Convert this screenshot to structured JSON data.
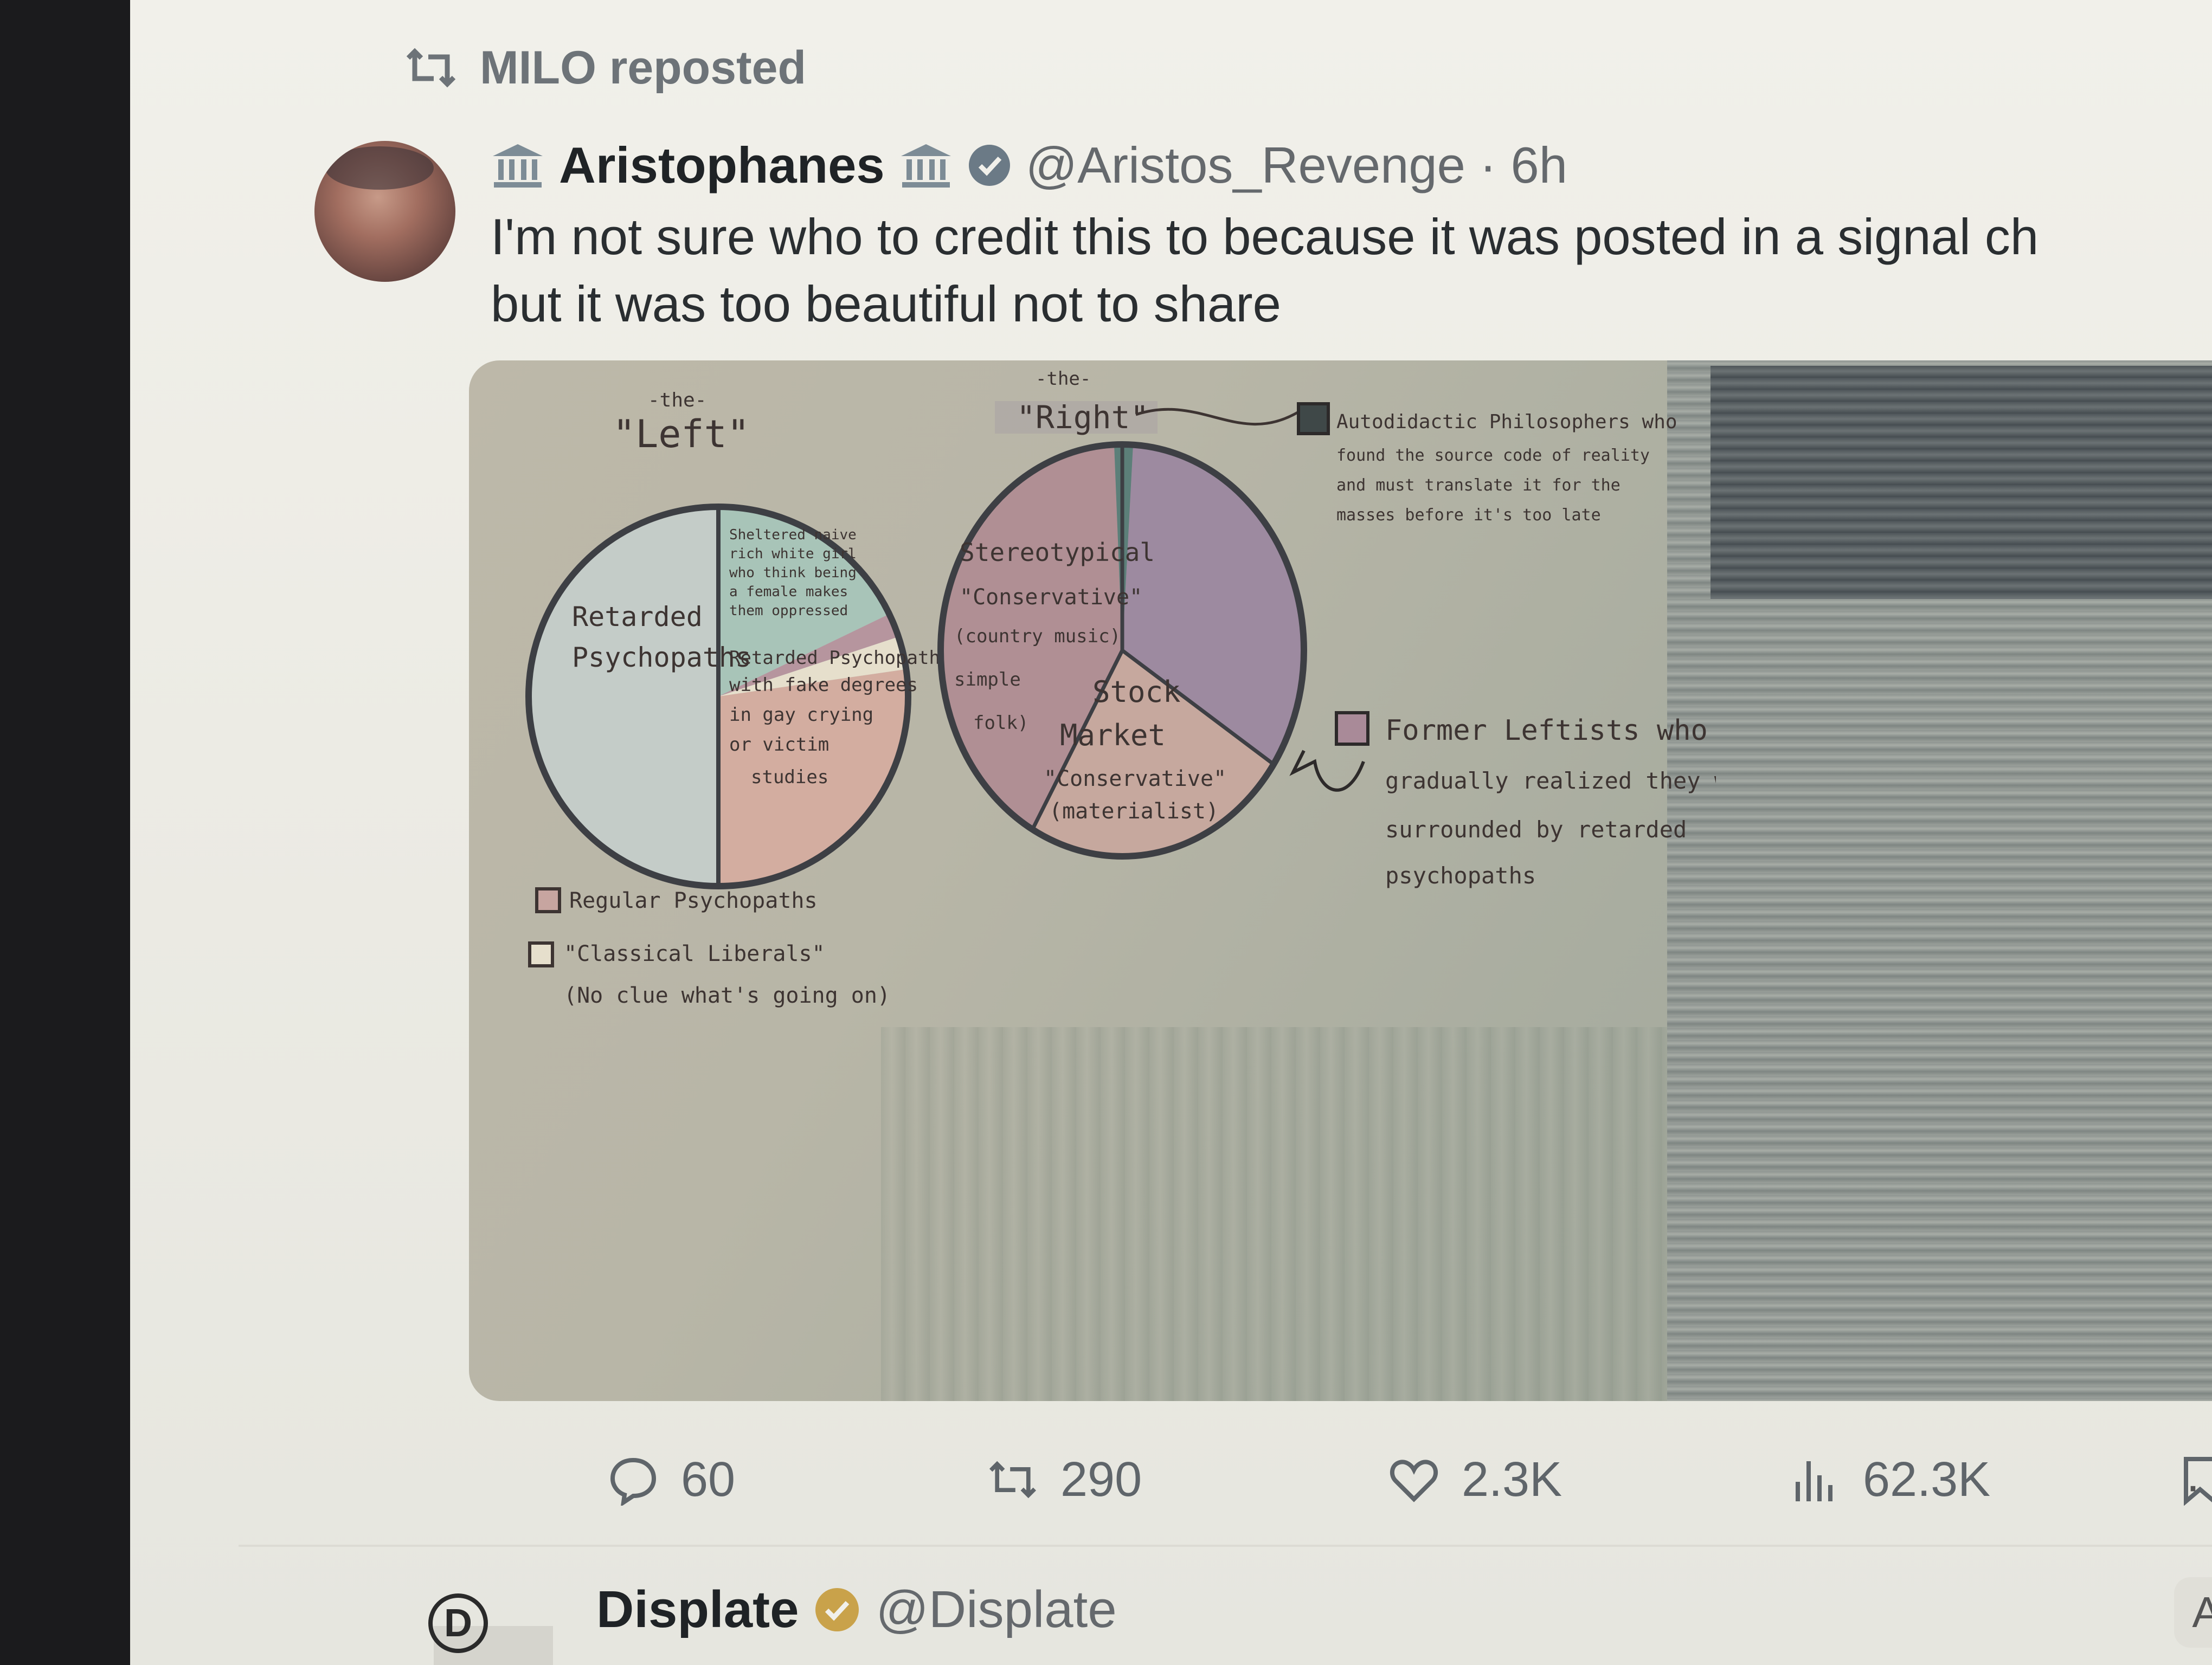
{
  "repost": {
    "text": "MILO reposted",
    "icon": "repost-icon"
  },
  "tweet": {
    "display_name": "Aristophanes",
    "handle_time": "@Aristos_Revenge · 6h",
    "text_line1": "I'm not sure who to credit this to because it was posted in a signal ch",
    "text_line2": "but it was too beautiful not to share",
    "verified_color": "#6b7a86"
  },
  "image": {
    "left_super": "-the-",
    "left_title": "\"Left\"",
    "right_super": "-the-",
    "right_title": "\"Right\"",
    "left_labels": {
      "retarded_psychopaths": [
        "Retarded",
        "Psychopaths"
      ],
      "sheltered": [
        "Sheltered naive",
        "rich white girl",
        "who think being",
        "a female makes",
        "them oppressed"
      ],
      "fake_degrees": [
        "Retarded Psychopaths",
        "with fake degrees",
        "in gay crying",
        "or victim",
        "studies"
      ]
    },
    "right_labels": {
      "stereotypical": [
        "Stereotypical",
        "\"Conservative\"",
        "(country music)",
        "simple",
        "folk)"
      ],
      "stock_market": [
        "Stock",
        "Market",
        "\"Conservative\"",
        "(materialist)"
      ]
    },
    "right_legend": {
      "autodidactic": [
        "Autodidactic Philosophers who",
        "found the source code of reality",
        "and must translate it for the",
        "masses before it's too late"
      ],
      "former_leftists": [
        "Former Leftists who",
        "gradually realized they were",
        "surrounded by retarded",
        "psychopaths"
      ]
    },
    "left_legend": {
      "regular": "Regular Psychopaths",
      "classical": "\"Classical Liberals\"",
      "classical_sub": "(No clue what's going on)"
    }
  },
  "actions": {
    "replies": "60",
    "reposts": "290",
    "likes": "2.3K",
    "views": "62.3K"
  },
  "next_tweet": {
    "display_name": "Displate",
    "handle": "@Displate",
    "badge_color": "#c9a24a",
    "edge_text": "A"
  }
}
